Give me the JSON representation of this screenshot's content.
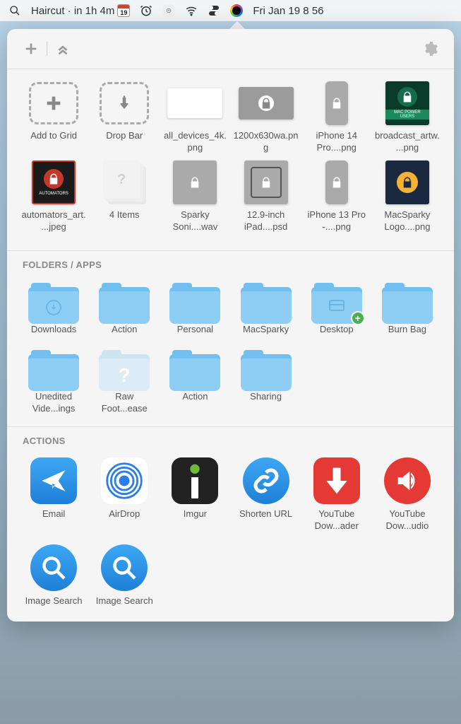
{
  "menubar": {
    "event_text": "Haircut · in 1h 4m",
    "cal_day": "19",
    "datetime": "Fri Jan 19  8 56"
  },
  "toolbar": {
    "add": "+",
    "collapse": "⌃"
  },
  "shelf": [
    {
      "label": "Add to Grid",
      "type": "add"
    },
    {
      "label": "Drop Bar",
      "type": "drop"
    },
    {
      "label": "all_devices_4k.png",
      "type": "img-wide"
    },
    {
      "label": "1200x630wa.png",
      "type": "img-lock-wide"
    },
    {
      "label": "iPhone 14 Pro....png",
      "type": "img-lock-tall"
    },
    {
      "label": "broadcast_artw....png",
      "type": "img-mpu"
    },
    {
      "label": "automators_art....jpeg",
      "type": "img-auto"
    },
    {
      "label": "4 Items",
      "type": "stack"
    },
    {
      "label": "Sparky Soni....wav",
      "type": "img-lock-sq"
    },
    {
      "label": "12.9-inch iPad....psd",
      "type": "img-lock-frame"
    },
    {
      "label": "iPhone 13 Pro -....png",
      "type": "img-lock-tall"
    },
    {
      "label": "MacSparky Logo....png",
      "type": "img-ms"
    }
  ],
  "folders_header": "FOLDERS / APPS",
  "folders": [
    {
      "label": "Downloads",
      "badge": "download"
    },
    {
      "label": "Action",
      "badge": ""
    },
    {
      "label": "Personal",
      "badge": ""
    },
    {
      "label": "MacSparky",
      "badge": ""
    },
    {
      "label": "Desktop",
      "badge": "desktop",
      "plus": true
    },
    {
      "label": "Burn Bag",
      "badge": ""
    },
    {
      "label": "Unedited Vide...ings",
      "badge": ""
    },
    {
      "label": "Raw Foot...ease",
      "badge": "question",
      "light": true
    },
    {
      "label": "Action",
      "badge": ""
    },
    {
      "label": "Sharing",
      "badge": ""
    }
  ],
  "actions_header": "ACTIONS",
  "actions": [
    {
      "label": "Email",
      "icon": "plane",
      "style": "ai-blue"
    },
    {
      "label": "AirDrop",
      "icon": "rings",
      "style": "ai-rings"
    },
    {
      "label": "Imgur",
      "icon": "imgur",
      "style": "ai-dark"
    },
    {
      "label": "Shorten URL",
      "icon": "link",
      "style": "ai-blue ai-round"
    },
    {
      "label": "YouTube Dow...ader",
      "icon": "dl",
      "style": "ai-red"
    },
    {
      "label": "YouTube Dow...udio",
      "icon": "audio",
      "style": "ai-red ai-round"
    },
    {
      "label": "Image Search",
      "icon": "search",
      "style": "ai-blue ai-round"
    },
    {
      "label": "Image Search",
      "icon": "search",
      "style": "ai-blue ai-round"
    }
  ]
}
